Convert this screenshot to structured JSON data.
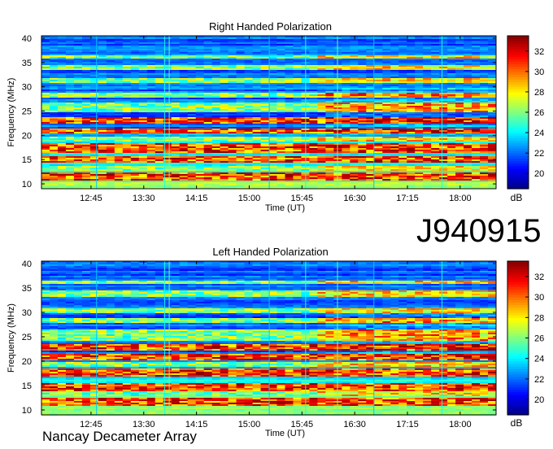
{
  "figure": {
    "id_label": "J940915",
    "footer": "Nancay Decameter Array"
  },
  "colorbar": {
    "unit": "dB",
    "ticks": [
      20,
      22,
      24,
      26,
      28,
      30,
      32
    ],
    "range": [
      18.5,
      33.5
    ],
    "colors": [
      "#00008b",
      "#0000ff",
      "#0080ff",
      "#00ffff",
      "#80ff80",
      "#ffff00",
      "#ff8000",
      "#ff0000",
      "#8b0000"
    ]
  },
  "chart_data": [
    {
      "type": "heatmap",
      "title": "Right Handed Polarization",
      "xlabel": "Time (UT)",
      "ylabel": "Frequency (MHz)",
      "x_ticks": [
        "12:45",
        "13:30",
        "14:15",
        "15:00",
        "15:45",
        "16:30",
        "17:15",
        "18:00"
      ],
      "y_ticks": [
        10,
        15,
        20,
        25,
        30,
        35,
        40
      ],
      "ylim": [
        9,
        40.5
      ],
      "z_unit": "dB",
      "z_range": [
        18.5,
        33.5
      ],
      "strong_bands_mhz": [
        [
          11,
          12.5
        ],
        [
          14.5,
          16
        ],
        [
          16.5,
          18.5
        ],
        [
          20.5,
          21.5
        ],
        [
          22.5,
          24
        ]
      ],
      "moderate_bands_mhz": [
        [
          13,
          14
        ],
        [
          19,
          20
        ],
        [
          25,
          27
        ],
        [
          28,
          29
        ],
        [
          31,
          32
        ],
        [
          33.5,
          34.5
        ],
        [
          36,
          36.5
        ]
      ]
    },
    {
      "type": "heatmap",
      "title": "Left Handed Polarization",
      "xlabel": "Time (UT)",
      "ylabel": "Frequency (MHz)",
      "x_ticks": [
        "12:45",
        "13:30",
        "14:15",
        "15:00",
        "15:45",
        "16:30",
        "17:15",
        "18:00"
      ],
      "y_ticks": [
        10,
        15,
        20,
        25,
        30,
        35,
        40
      ],
      "ylim": [
        9,
        40.5
      ],
      "z_unit": "dB",
      "z_range": [
        18.5,
        33.5
      ],
      "strong_bands_mhz": [
        [
          11,
          12.5
        ],
        [
          14,
          15.5
        ],
        [
          17,
          18.5
        ],
        [
          20.5,
          21.5
        ],
        [
          22.5,
          23.5
        ]
      ],
      "moderate_bands_mhz": [
        [
          13,
          14
        ],
        [
          19,
          20
        ],
        [
          24.5,
          26.5
        ],
        [
          28,
          29
        ],
        [
          30,
          31
        ],
        [
          33.5,
          34.5
        ],
        [
          36,
          36.5
        ]
      ]
    }
  ]
}
